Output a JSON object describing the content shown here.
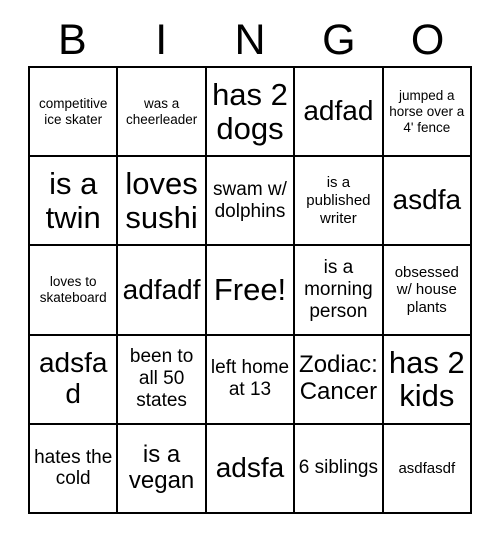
{
  "card": {
    "header_letters": [
      "B",
      "I",
      "N",
      "G",
      "O"
    ],
    "free_space_label": "Free!",
    "rows": [
      [
        {
          "text": "competitive ice skater",
          "size": "xs"
        },
        {
          "text": "was a cheerleader",
          "size": "xs"
        },
        {
          "text": "has 2 dogs",
          "size": "xxl"
        },
        {
          "text": "adfad",
          "size": "xl"
        },
        {
          "text": "jumped a horse over a 4' fence",
          "size": "xs"
        }
      ],
      [
        {
          "text": "is a twin",
          "size": "xxl"
        },
        {
          "text": "loves sushi",
          "size": "xxl"
        },
        {
          "text": "swam w/ dolphins",
          "size": "md"
        },
        {
          "text": "is a published writer",
          "size": "sm"
        },
        {
          "text": "asdfa",
          "size": "xl"
        }
      ],
      [
        {
          "text": "loves to skateboard",
          "size": "xs"
        },
        {
          "text": "adfadf",
          "size": "xl"
        },
        {
          "text": "Free!",
          "size": "xxl"
        },
        {
          "text": "is a morning person",
          "size": "md"
        },
        {
          "text": "obsessed w/ house plants",
          "size": "sm"
        }
      ],
      [
        {
          "text": "adsfad",
          "size": "xl"
        },
        {
          "text": "been to all 50 states",
          "size": "md"
        },
        {
          "text": "left home at 13",
          "size": "md"
        },
        {
          "text": "Zodiac: Cancer",
          "size": "lg"
        },
        {
          "text": "has 2 kids",
          "size": "xxl"
        }
      ],
      [
        {
          "text": "hates the cold",
          "size": "md"
        },
        {
          "text": "is a vegan",
          "size": "lg"
        },
        {
          "text": "adsfa",
          "size": "xl"
        },
        {
          "text": "6 siblings",
          "size": "md"
        },
        {
          "text": "asdfasdf",
          "size": "sm"
        }
      ]
    ]
  },
  "colors": {
    "background": "#ffffff",
    "text": "#000000",
    "grid_line": "#000000"
  }
}
